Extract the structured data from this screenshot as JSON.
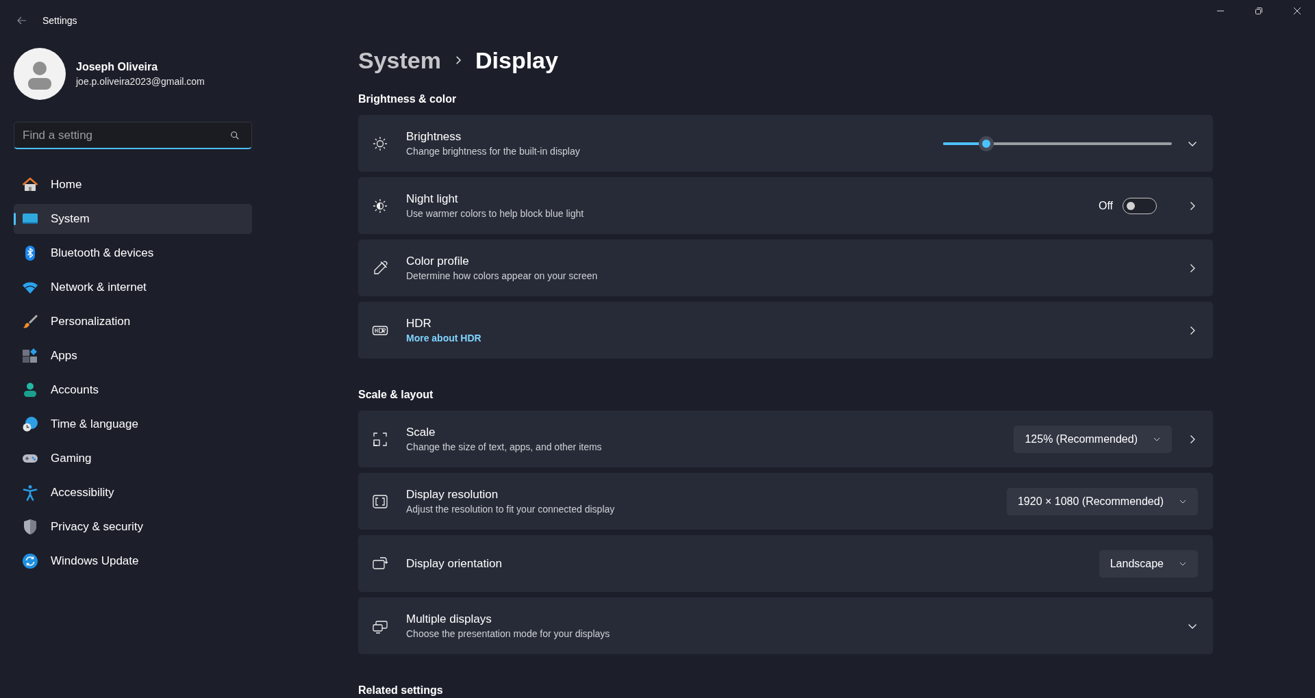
{
  "window": {
    "title": "Settings"
  },
  "user": {
    "name": "Joseph Oliveira",
    "email": "joe.p.oliveira2023@gmail.com"
  },
  "search": {
    "placeholder": "Find a setting"
  },
  "nav": [
    {
      "label": "Home",
      "selected": false
    },
    {
      "label": "System",
      "selected": true
    },
    {
      "label": "Bluetooth & devices",
      "selected": false
    },
    {
      "label": "Network & internet",
      "selected": false
    },
    {
      "label": "Personalization",
      "selected": false
    },
    {
      "label": "Apps",
      "selected": false
    },
    {
      "label": "Accounts",
      "selected": false
    },
    {
      "label": "Time & language",
      "selected": false
    },
    {
      "label": "Gaming",
      "selected": false
    },
    {
      "label": "Accessibility",
      "selected": false
    },
    {
      "label": "Privacy & security",
      "selected": false
    },
    {
      "label": "Windows Update",
      "selected": false
    }
  ],
  "breadcrumb": [
    "System",
    "Display"
  ],
  "sections": [
    {
      "title": "Brightness & color",
      "rows": [
        {
          "kind": "expand",
          "title": "Brightness",
          "subtitle": "Change brightness for the built-in display",
          "control": {
            "kind": "slider",
            "level": 0.19
          }
        },
        {
          "kind": "navigate",
          "title": "Night light",
          "subtitle": "Use warmer colors to help block blue light",
          "control": {
            "kind": "toggle",
            "on": false,
            "label": "Off"
          }
        },
        {
          "kind": "navigate",
          "title": "Color profile",
          "subtitle": "Determine how colors appear on your screen"
        },
        {
          "kind": "navigate",
          "title": "HDR",
          "link": "More about HDR"
        }
      ]
    },
    {
      "title": "Scale & layout",
      "rows": [
        {
          "kind": "navigate",
          "title": "Scale",
          "subtitle": "Change the size of text, apps, and other items",
          "control": {
            "kind": "dropdown",
            "value": "125% (Recommended)"
          }
        },
        {
          "kind": "plain",
          "title": "Display resolution",
          "subtitle": "Adjust the resolution to fit your connected display",
          "control": {
            "kind": "dropdown",
            "value": "1920 × 1080 (Recommended)"
          }
        },
        {
          "kind": "plain",
          "title": "Display orientation",
          "control": {
            "kind": "dropdown",
            "value": "Landscape"
          }
        },
        {
          "kind": "expand",
          "title": "Multiple displays",
          "subtitle": "Choose the presentation mode for your displays"
        }
      ]
    },
    {
      "title": "Related settings"
    }
  ]
}
